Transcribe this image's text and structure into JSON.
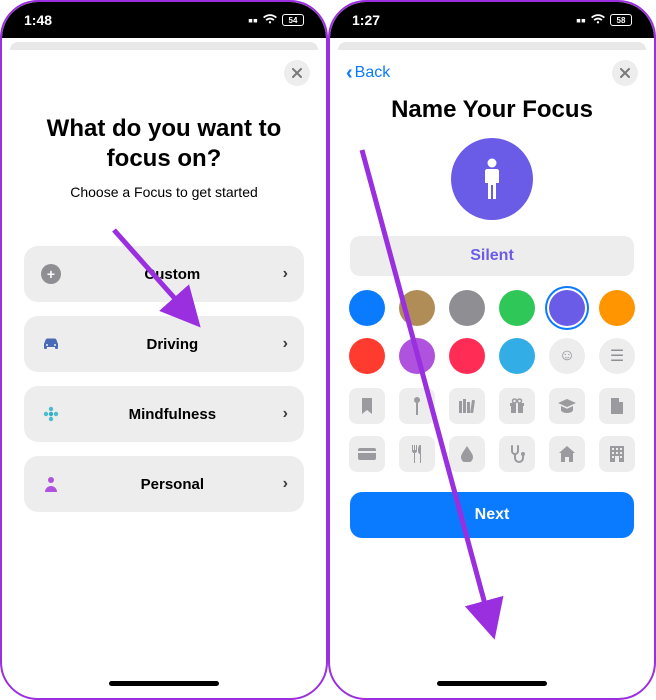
{
  "left": {
    "status_time": "1:48",
    "battery": "54",
    "title": "What do you want to focus on?",
    "subtitle": "Choose a Focus to get started",
    "rows": [
      {
        "icon": "plus",
        "label": "Custom"
      },
      {
        "icon": "car",
        "label": "Driving"
      },
      {
        "icon": "flower",
        "label": "Mindfulness"
      },
      {
        "icon": "person",
        "label": "Personal"
      }
    ]
  },
  "right": {
    "status_time": "1:27",
    "battery": "58",
    "back_label": "Back",
    "title": "Name Your Focus",
    "name_value": "Silent",
    "colors": [
      {
        "hex": "#0a7aff",
        "selected": false
      },
      {
        "hex": "#b08d57",
        "selected": false
      },
      {
        "hex": "#8e8e93",
        "selected": false
      },
      {
        "hex": "#30c759",
        "selected": false
      },
      {
        "hex": "#6b5ce7",
        "selected": true
      },
      {
        "hex": "#ff9500",
        "selected": false
      },
      {
        "hex": "#ff3b30",
        "selected": false
      },
      {
        "hex": "#af52de",
        "selected": false
      },
      {
        "hex": "#ff2d55",
        "selected": false
      },
      {
        "hex": "#32ade6",
        "selected": false
      }
    ],
    "extra_swatches": [
      "smile",
      "list"
    ],
    "icons_row1": [
      "bookmark",
      "pin",
      "books",
      "gift",
      "graduation",
      "document"
    ],
    "icons_row2": [
      "credit-card",
      "utensils",
      "droplet",
      "stethoscope",
      "home",
      "building"
    ],
    "next_label": "Next"
  }
}
